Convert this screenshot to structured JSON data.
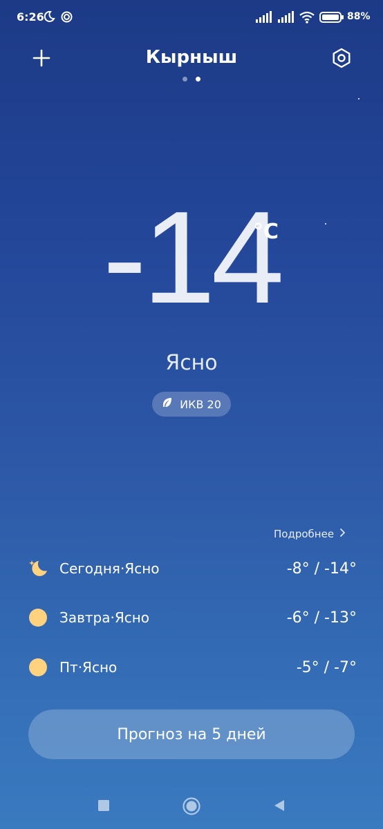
{
  "status_bar": {
    "time": "6:26",
    "battery_percent": "88%",
    "icons": [
      "moon-icon",
      "hotspot-icon",
      "signal-icon",
      "signal-icon",
      "wifi-icon",
      "battery-icon"
    ]
  },
  "header": {
    "city": "Кырныш",
    "add_icon": "plus-icon",
    "settings_icon": "settings-hexagon-icon",
    "pages": {
      "count": 2,
      "active_index": 1
    }
  },
  "current": {
    "temperature": "-14",
    "unit": "°C",
    "condition": "Ясно",
    "aqi_label": "ИКВ 20",
    "aqi_icon": "leaf-icon"
  },
  "details_link": "Подробнее",
  "forecast": [
    {
      "label": "Сегодня·Ясно",
      "temps": "-8° / -14°",
      "icon": "moon-icon"
    },
    {
      "label": "Завтра·Ясно",
      "temps": "-6° / -13°",
      "icon": "sun-icon"
    },
    {
      "label": "Пт·Ясно",
      "temps": "-5° / -7°",
      "icon": "sun-icon"
    }
  ],
  "forecast_button": "Прогноз на 5 дней",
  "nav": [
    "recents-square-icon",
    "home-circle-icon",
    "back-triangle-icon"
  ],
  "colors": {
    "background_top": "#1c3a86",
    "background_bottom": "#3a7abf",
    "sun": "#ffd27f",
    "text": "#ffffff"
  }
}
